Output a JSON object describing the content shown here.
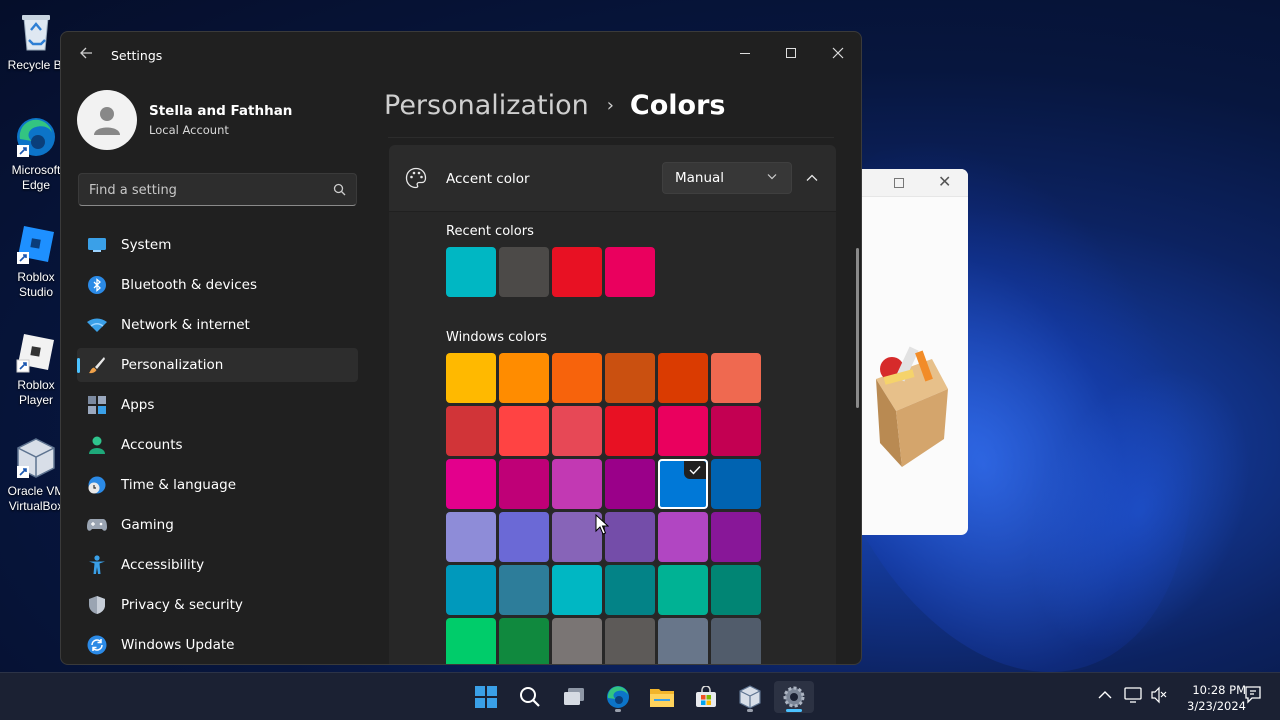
{
  "desktop": {
    "icons": [
      {
        "label": "Recycle Bi",
        "icon": "recycle-bin-icon"
      },
      {
        "label": "Microsoft\nEdge",
        "icon": "edge-icon"
      },
      {
        "label": "Roblox\nStudio",
        "icon": "roblox-studio-icon"
      },
      {
        "label": "Roblox\nPlayer",
        "icon": "roblox-player-icon"
      },
      {
        "label": "Oracle VM\nVirtualBox",
        "icon": "virtualbox-icon"
      }
    ]
  },
  "window": {
    "title": "Settings"
  },
  "profile": {
    "name": "Stella and Fathhan",
    "account_type": "Local Account"
  },
  "search": {
    "placeholder": "Find a setting"
  },
  "nav": {
    "items": [
      {
        "label": "System",
        "icon": "system-icon"
      },
      {
        "label": "Bluetooth & devices",
        "icon": "bluetooth-icon"
      },
      {
        "label": "Network & internet",
        "icon": "wifi-icon"
      },
      {
        "label": "Personalization",
        "icon": "brush-icon",
        "active": true
      },
      {
        "label": "Apps",
        "icon": "apps-icon"
      },
      {
        "label": "Accounts",
        "icon": "person-icon"
      },
      {
        "label": "Time & language",
        "icon": "globe-clock-icon"
      },
      {
        "label": "Gaming",
        "icon": "controller-icon"
      },
      {
        "label": "Accessibility",
        "icon": "accessibility-icon"
      },
      {
        "label": "Privacy & security",
        "icon": "shield-icon"
      },
      {
        "label": "Windows Update",
        "icon": "update-icon"
      }
    ]
  },
  "breadcrumb": {
    "parent": "Personalization",
    "separator": "›",
    "current": "Colors"
  },
  "accent": {
    "label": "Accent color",
    "mode_value": "Manual",
    "expanded": true
  },
  "recent_colors": {
    "label": "Recent colors",
    "colors": [
      "#00B7C3",
      "#4C4A48",
      "#E81123",
      "#EA005E"
    ]
  },
  "windows_colors": {
    "label": "Windows colors",
    "selected": "#0078D7",
    "rows": [
      [
        "#FFB900",
        "#FF8C00",
        "#F7630C",
        "#CA5010",
        "#DA3B01",
        "#EF6950"
      ],
      [
        "#D13438",
        "#FF4343",
        "#E74856",
        "#E81123",
        "#EA005E",
        "#C30052"
      ],
      [
        "#E3008C",
        "#BF0077",
        "#C239B3",
        "#9A0089",
        "#0078D7",
        "#0063B1"
      ],
      [
        "#8E8CD8",
        "#6B69D6",
        "#8764B8",
        "#744DA9",
        "#B146C2",
        "#881798"
      ],
      [
        "#0099BC",
        "#2D7D9A",
        "#00B7C3",
        "#038387",
        "#00B294",
        "#018574"
      ],
      [
        "#00CC6A",
        "#10893E",
        "#7A7574",
        "#5D5A58",
        "#68768A",
        "#515C6B"
      ]
    ]
  },
  "taskbar": {
    "apps": [
      "start-icon",
      "search-icon",
      "task-view-icon",
      "edge-icon",
      "file-explorer-icon",
      "store-icon",
      "virtualbox-icon",
      "settings-icon"
    ],
    "time": "10:28 PM",
    "date": "3/23/2024"
  },
  "colors": {
    "accent_link": "#4CC2FF",
    "window_bg": "#202020",
    "card_bg": "#2B2B2B"
  }
}
